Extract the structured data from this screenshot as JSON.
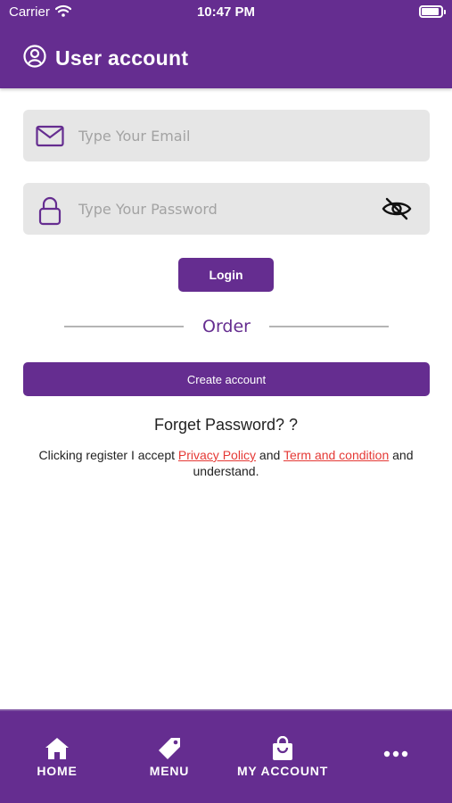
{
  "status_bar": {
    "carrier": "Carrier",
    "time": "10:47 PM",
    "battery_level": 0.92
  },
  "header": {
    "title": "User account",
    "icon": "user-circle-icon"
  },
  "form": {
    "email": {
      "placeholder": "Type Your Email",
      "value": "",
      "icon": "envelope-icon"
    },
    "password": {
      "placeholder": "Type Your Password",
      "value": "",
      "icon": "lock-icon",
      "toggle_icon": "eye-off-icon"
    },
    "login_label": "Login"
  },
  "divider": {
    "label": "Order"
  },
  "create_account_label": "Create account",
  "forget_password": "Forget Password? ?",
  "terms": {
    "prefix": "Clicking register I accept ",
    "privacy_link": "Privacy Policy",
    "and": " and ",
    "terms_link": "Term and condition",
    "suffix": " and understand."
  },
  "tabbar": {
    "items": [
      {
        "label": "HOME",
        "icon": "home-icon"
      },
      {
        "label": "MENU",
        "icon": "tag-icon"
      },
      {
        "label": "MY ACCOUNT",
        "icon": "shopping-bag-icon"
      },
      {
        "label": "",
        "icon": "more-icon"
      }
    ]
  },
  "colors": {
    "brand": "#652d90",
    "field_bg": "#e6e6e6",
    "link": "#e53935",
    "placeholder": "#a3a3a3"
  }
}
